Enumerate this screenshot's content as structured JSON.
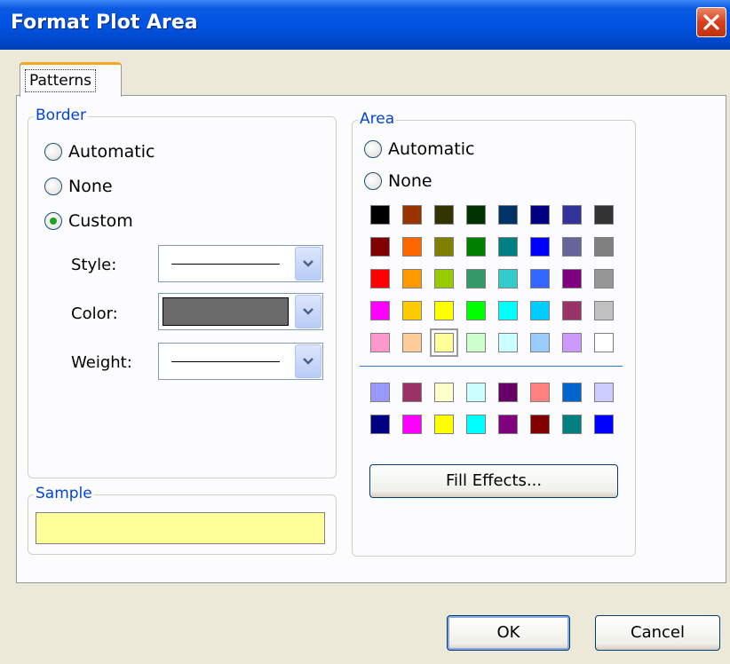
{
  "window": {
    "title": "Format Plot Area"
  },
  "tabs": [
    {
      "label": "Patterns"
    }
  ],
  "border": {
    "legend": "Border",
    "options": [
      {
        "label": "Automatic",
        "selected": false
      },
      {
        "label": "None",
        "selected": false
      },
      {
        "label": "Custom",
        "selected": true
      }
    ],
    "style_label": "Style:",
    "color_label": "Color:",
    "weight_label": "Weight:",
    "style_value": "solid line",
    "color_value": "#6b6b6b",
    "weight_value": "thin line"
  },
  "sample": {
    "legend": "Sample",
    "color": "#ffff99"
  },
  "area": {
    "legend": "Area",
    "options": [
      {
        "label": "Automatic",
        "selected": false
      },
      {
        "label": "None",
        "selected": false
      }
    ],
    "palette_main": [
      [
        "#000000",
        "#993300",
        "#333300",
        "#003300",
        "#003366",
        "#000080",
        "#333399",
        "#333333"
      ],
      [
        "#800000",
        "#ff6600",
        "#808000",
        "#008000",
        "#008080",
        "#0000ff",
        "#666699",
        "#808080"
      ],
      [
        "#ff0000",
        "#ff9900",
        "#99cc00",
        "#339966",
        "#33cccc",
        "#3366ff",
        "#800080",
        "#969696"
      ],
      [
        "#ff00ff",
        "#ffcc00",
        "#ffff00",
        "#00ff00",
        "#00ffff",
        "#00ccff",
        "#993366",
        "#c0c0c0"
      ],
      [
        "#ff99cc",
        "#ffcc99",
        "#ffff99",
        "#ccffcc",
        "#ccffff",
        "#99ccff",
        "#cc99ff",
        "#ffffff"
      ]
    ],
    "palette_chart": [
      [
        "#9999ff",
        "#993366",
        "#ffffcc",
        "#ccffff",
        "#660066",
        "#ff8080",
        "#0066cc",
        "#ccccff"
      ],
      [
        "#000080",
        "#ff00ff",
        "#ffff00",
        "#00ffff",
        "#800080",
        "#800000",
        "#008080",
        "#0000ff"
      ]
    ],
    "selected_color": "#ffff99",
    "fill_effects_label": "Fill Effects..."
  },
  "buttons": {
    "ok": "OK",
    "cancel": "Cancel"
  }
}
